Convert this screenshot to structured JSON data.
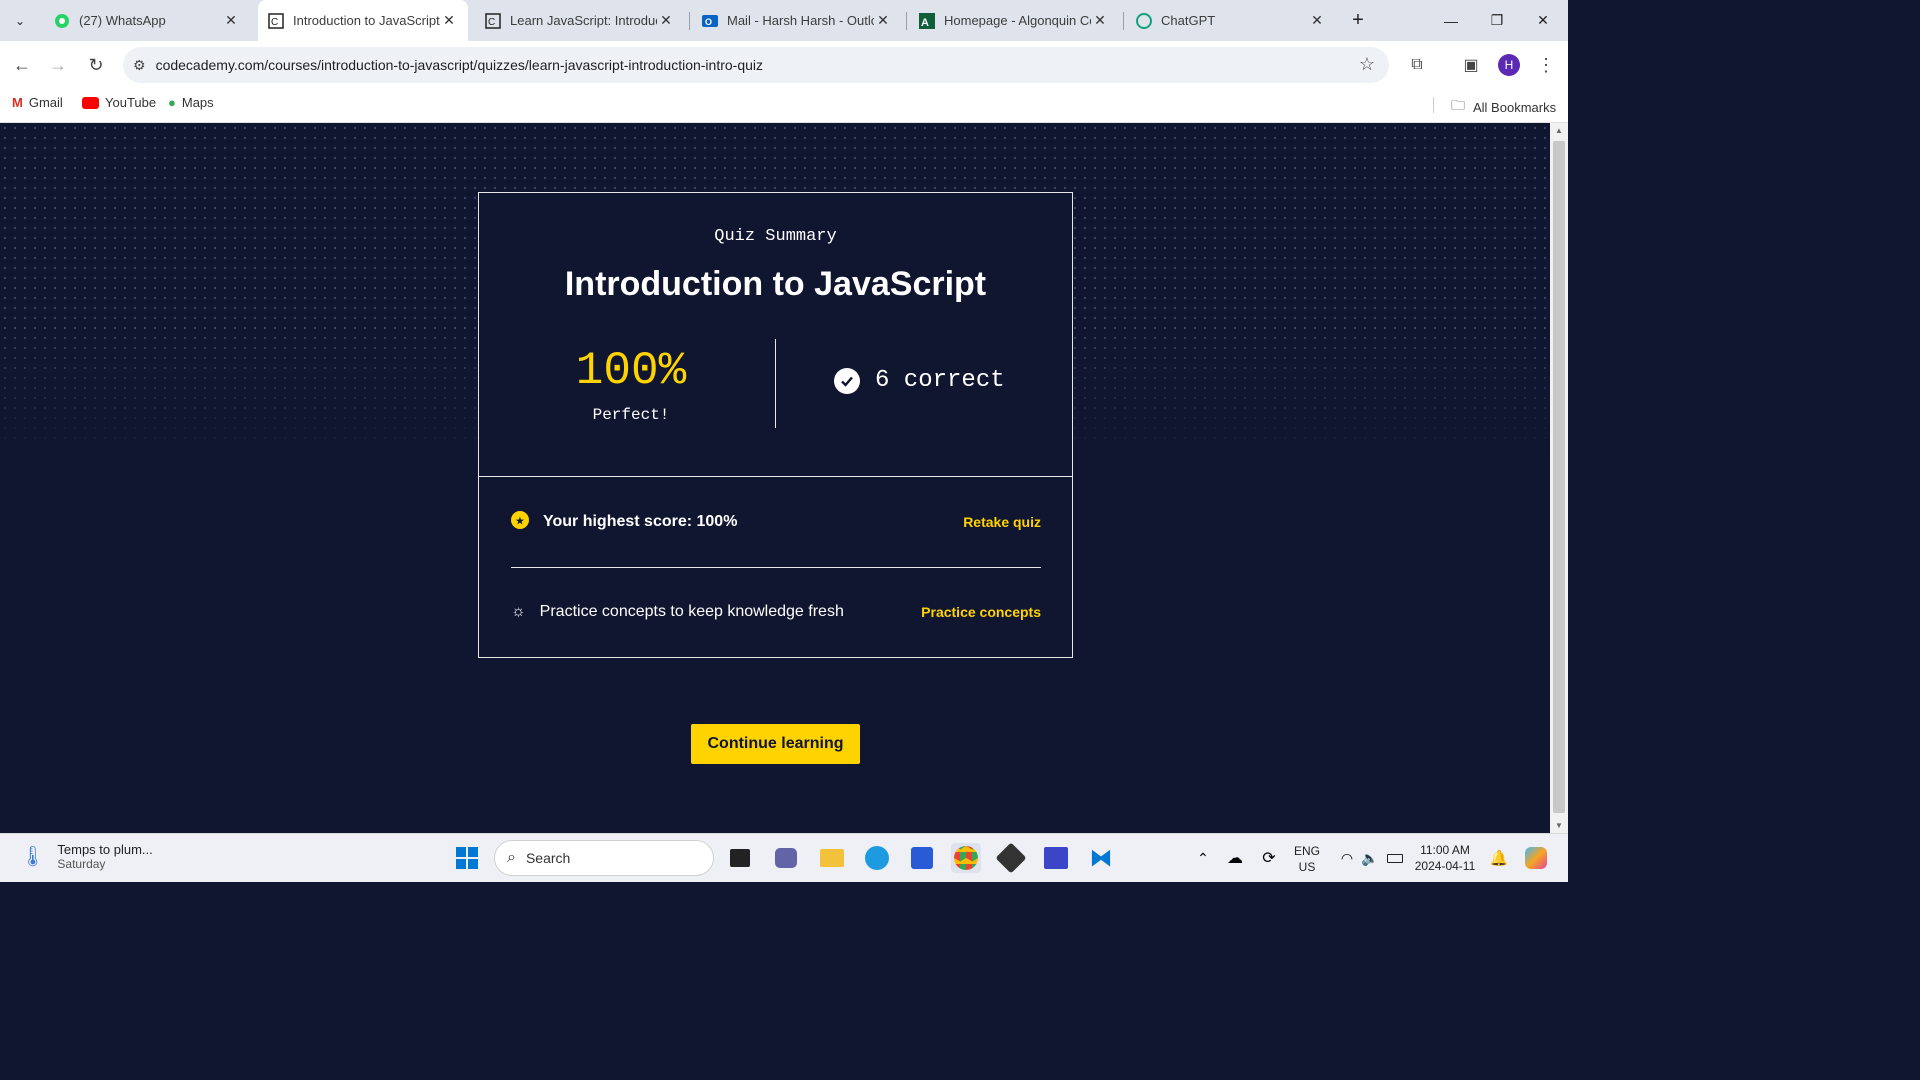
{
  "browser": {
    "tabs": [
      {
        "title": "(27) WhatsApp",
        "icon": "whatsapp-icon"
      },
      {
        "title": "Introduction to JavaScript |",
        "icon": "codecademy-icon",
        "active": true
      },
      {
        "title": "Learn JavaScript: Introducti",
        "icon": "codecademy-icon"
      },
      {
        "title": "Mail - Harsh Harsh - Outlo",
        "icon": "outlook-icon"
      },
      {
        "title": "Homepage - Algonquin Co",
        "icon": "algonquin-icon"
      },
      {
        "title": "ChatGPT",
        "icon": "chatgpt-icon"
      }
    ],
    "url": "codecademy.com/courses/introduction-to-javascript/quizzes/learn-javascript-introduction-intro-quiz",
    "profile_initial": "H",
    "bookmarks": [
      {
        "label": "Gmail",
        "icon": "gmail-icon"
      },
      {
        "label": "YouTube",
        "icon": "youtube-icon"
      },
      {
        "label": "Maps",
        "icon": "maps-icon"
      }
    ],
    "all_bookmarks": "All Bookmarks"
  },
  "quiz": {
    "kicker": "Quiz Summary",
    "title": "Introduction to JavaScript",
    "score": "100%",
    "score_note": "Perfect!",
    "correct": "6 correct",
    "highest_score": "Your highest score: 100%",
    "retake_label": "Retake quiz",
    "practice_text": "Practice concepts to keep knowledge fresh",
    "practice_label": "Practice concepts",
    "continue_label": "Continue learning"
  },
  "taskbar": {
    "weather_title": "Temps to plum...",
    "weather_sub": "Saturday",
    "search_placeholder": "Search",
    "lang_top": "ENG",
    "lang_bottom": "US",
    "time": "11:00 AM",
    "date": "2024-04-11"
  },
  "colors": {
    "accent": "#ffd300",
    "page_bg": "#101530"
  }
}
